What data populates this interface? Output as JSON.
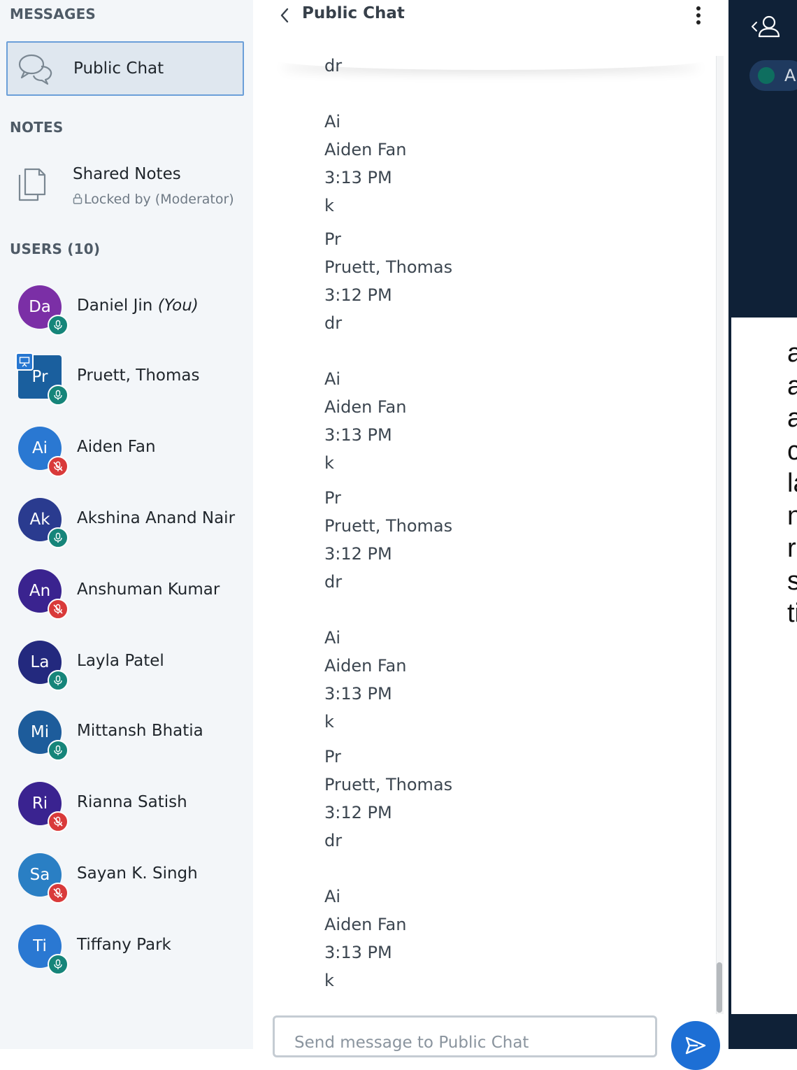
{
  "sidebar": {
    "messages_title": "MESSAGES",
    "public_chat_label": "Public Chat",
    "notes_title": "NOTES",
    "shared_notes": {
      "title": "Shared Notes",
      "status": "Locked by (Moderator)"
    },
    "users_title": "USERS (10)",
    "users": [
      {
        "initials": "Da",
        "name": "Daniel Jin",
        "suffix": "(You)",
        "color": "#7b2fa6",
        "mic": "on"
      },
      {
        "initials": "Pr",
        "name": "Pruett, Thomas",
        "suffix": "",
        "color": "#1a5f9e",
        "mic": "on",
        "presenter": true
      },
      {
        "initials": "Ai",
        "name": "Aiden Fan",
        "suffix": "",
        "color": "#2a78d2",
        "mic": "off"
      },
      {
        "initials": "Ak",
        "name": "Akshina Anand Nair",
        "suffix": "",
        "color": "#2a3b8f",
        "mic": "on"
      },
      {
        "initials": "An",
        "name": "Anshuman Kumar",
        "suffix": "",
        "color": "#3a238f",
        "mic": "off"
      },
      {
        "initials": "La",
        "name": "Layla Patel",
        "suffix": "",
        "color": "#23297e",
        "mic": "on"
      },
      {
        "initials": "Mi",
        "name": "Mittansh Bhatia",
        "suffix": "",
        "color": "#1d5c9b",
        "mic": "on"
      },
      {
        "initials": "Ri",
        "name": "Rianna Satish",
        "suffix": "",
        "color": "#3a2390",
        "mic": "off"
      },
      {
        "initials": "Sa",
        "name": "Sayan K. Singh",
        "suffix": "",
        "color": "#2a7fc4",
        "mic": "off"
      },
      {
        "initials": "Ti",
        "name": "Tiffany Park",
        "suffix": "",
        "color": "#2a78d2",
        "mic": "on"
      }
    ]
  },
  "chat": {
    "title": "Public Chat",
    "input_placeholder": "Send message to Public Chat",
    "messages": [
      {
        "lines": [
          "dr"
        ]
      },
      {
        "lines": [
          "Ai",
          "Aiden Fan",
          "3:13 PM",
          "k"
        ]
      },
      {
        "lines": [
          "Pr",
          "Pruett, Thomas",
          "3:12 PM",
          "dr"
        ]
      },
      {
        "lines": [
          "Ai",
          "Aiden Fan",
          "3:13 PM",
          "k"
        ]
      },
      {
        "lines": [
          "Pr",
          "Pruett, Thomas",
          "3:12 PM",
          "dr"
        ]
      },
      {
        "lines": [
          "Ai",
          "Aiden Fan",
          "3:13 PM",
          "k"
        ]
      },
      {
        "lines": [
          "Pr",
          "Pruett, Thomas",
          "3:12 PM",
          "dr"
        ]
      },
      {
        "lines": [
          "Ai",
          "Aiden Fan",
          "3:13 PM",
          "k"
        ]
      }
    ]
  },
  "presentation": {
    "pill_letter": "A",
    "slide_fragments": [
      "a",
      "a",
      "a",
      "c",
      "la",
      "n",
      "r",
      "s",
      "ti"
    ]
  },
  "icons": {
    "back": "chevron-left-icon",
    "more": "vertical-dots-icon",
    "send": "send-icon",
    "chat": "chat-bubbles-icon",
    "notes": "notes-icon",
    "lock": "lock-icon",
    "mic_on": "microphone-icon",
    "mic_off": "microphone-muted-icon",
    "presenter": "presenter-icon",
    "users_toggle": "user-icon"
  }
}
